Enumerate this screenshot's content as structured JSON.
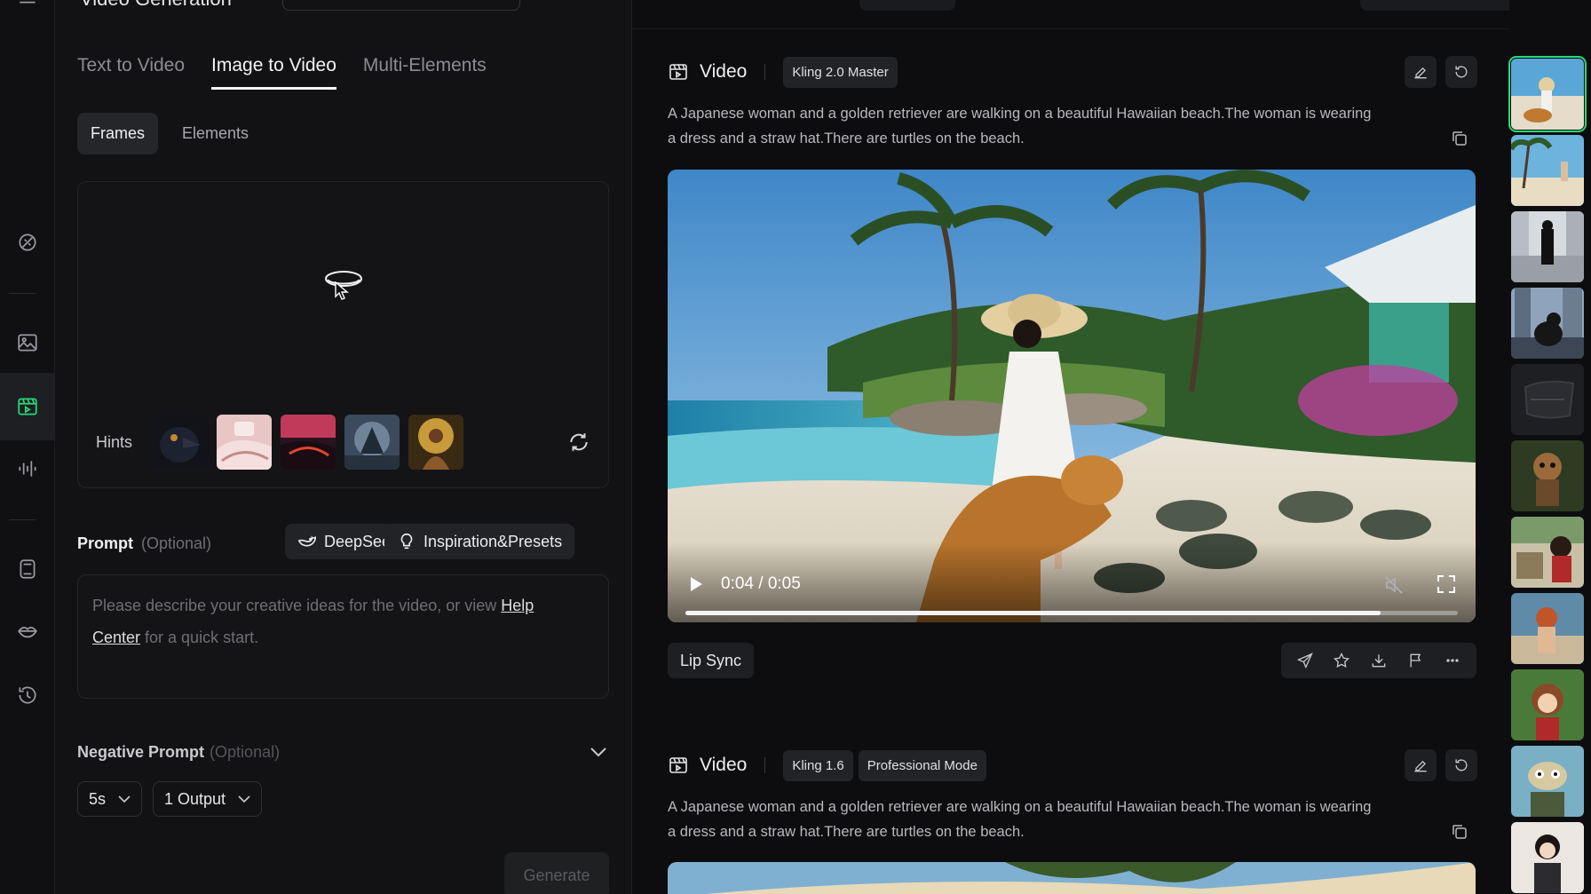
{
  "header": {
    "title": "Video Generation"
  },
  "tabs": [
    {
      "label": "Text to Video"
    },
    {
      "label": "Image to Video"
    },
    {
      "label": "Multi-Elements"
    }
  ],
  "subtabs": [
    {
      "label": "Frames"
    },
    {
      "label": "Elements"
    }
  ],
  "upload": {
    "hints_label": "Hints"
  },
  "prompt": {
    "label": "Prompt",
    "optional": "(Optional)",
    "deepseek_label": "DeepSeek",
    "inspiration_label": "Inspiration&Presets",
    "placeholder_before": "Please describe your creative ideas for the video, or view ",
    "help_link_1": "Help",
    "help_link_2": "Center",
    "placeholder_after": " for a quick start."
  },
  "negative_prompt": {
    "label": "Negative Prompt",
    "optional": "(Optional)"
  },
  "settings": {
    "duration": "5s",
    "outputs": "1 Output"
  },
  "generate_label": "Generate",
  "cards": [
    {
      "title": "Video",
      "badges": [
        "Kling 2.0 Master"
      ],
      "description": "A Japanese woman and a golden retriever are walking on a beautiful Hawaiian beach.The woman is wearing a dress and a straw hat.There are turtles on the beach.",
      "time": "0:04 / 0:05",
      "progress": 0.9,
      "lip_sync_label": "Lip Sync"
    },
    {
      "title": "Video",
      "badges": [
        "Kling 1.6",
        "Professional Mode"
      ],
      "description": "A Japanese woman and a golden retriever are walking on a beautiful Hawaiian beach.The woman is wearing a dress and a straw hat.There are turtles on the beach."
    }
  ],
  "colors": {
    "accent": "#29d978",
    "background": "#0b0b0d",
    "panel": "#121214"
  },
  "icons": {
    "rail": [
      "magic-brush-icon",
      "image-icon",
      "video-icon",
      "audio-wave-icon",
      "effects-icon",
      "lip-icon",
      "history-icon"
    ],
    "toolbar": [
      "send-icon",
      "star-icon",
      "download-icon",
      "flag-icon",
      "more-icon"
    ]
  }
}
